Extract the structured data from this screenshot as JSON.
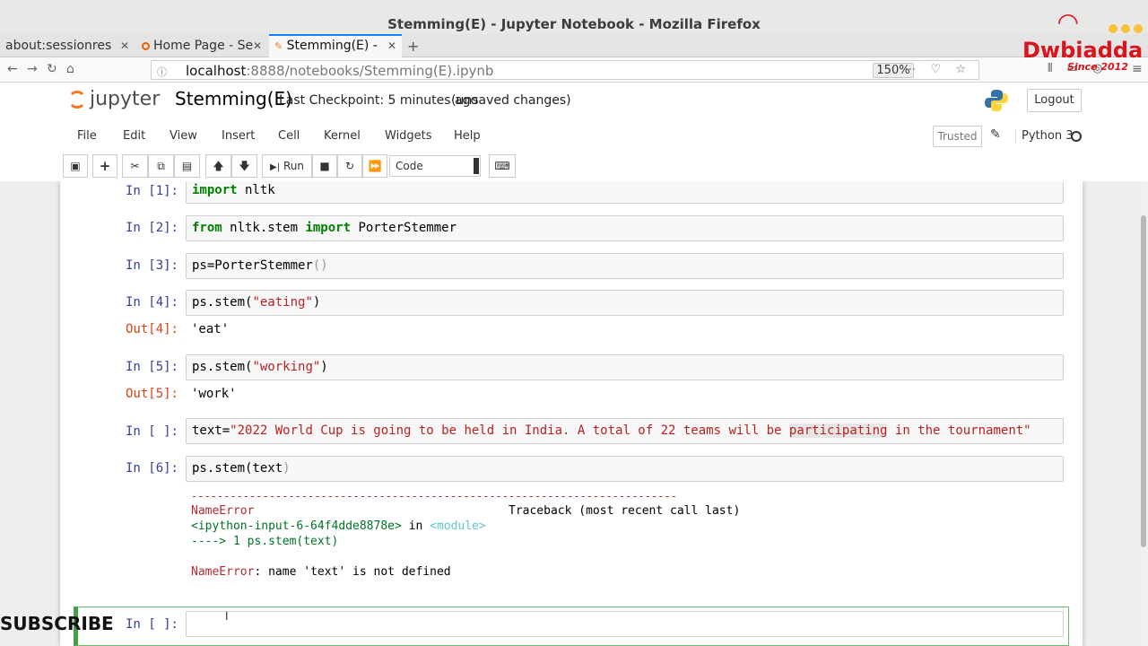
{
  "window": {
    "title": "Stemming(E) - Jupyter Notebook - Mozilla Firefox"
  },
  "tabs": [
    {
      "label": "about:sessionres"
    },
    {
      "label": "Home Page - Se"
    },
    {
      "label": "Stemming(E) -"
    }
  ],
  "address": {
    "host": "localhost",
    "path": ":8888/notebooks/Stemming(E).ipynb",
    "zoom": "150%"
  },
  "brand": {
    "name": "Dwbiadda",
    "since": "Since 2012"
  },
  "jupyter": {
    "logo_text": "jupyter",
    "notebook_name": "Stemming(E)",
    "checkpoint": "Last Checkpoint: 5 minutes ago",
    "status": "(unsaved changes)",
    "logout_label": "Logout"
  },
  "menu": {
    "items": [
      "File",
      "Edit",
      "View",
      "Insert",
      "Cell",
      "Kernel",
      "Widgets",
      "Help"
    ],
    "trusted_label": "Trusted",
    "kernel_name": "Python 3"
  },
  "toolbar": {
    "run_label": "Run",
    "cell_type": "Code"
  },
  "cells": [
    {
      "prompt": "In [1]:",
      "code": "import nltk"
    },
    {
      "prompt": "In [2]:",
      "code": "from nltk.stem import PorterStemmer"
    },
    {
      "prompt": "In [3]:",
      "code": "ps=PorterStemmer()"
    },
    {
      "prompt": "In [4]:",
      "code": "ps.stem(\"eating\")",
      "out_prompt": "Out[4]:",
      "output": "'eat'"
    },
    {
      "prompt": "In [5]:",
      "code": "ps.stem(\"working\")",
      "out_prompt": "Out[5]:",
      "output": "'work'"
    },
    {
      "prompt": "In [ ]:",
      "code": "text=\"2022 World Cup is going to be held in India. A total of 22 teams will be participating in the tournament\""
    },
    {
      "prompt": "In [6]:",
      "code": "ps.stem(text)"
    },
    {
      "prompt": "In [ ]:",
      "code": ""
    }
  ],
  "traceback": {
    "dashes": "---------------------------------------------------------------------------",
    "error_name": "NameError",
    "header_right": "Traceback (most recent call last)",
    "input_ref": "<ipython-input-6-64f4dde8878e>",
    "in_word": "in",
    "module": "<module>",
    "arrow_line": "----> 1 ps.stem(text)",
    "error_name2": "NameError",
    "message": ": name 'text' is not defined"
  },
  "overlay": {
    "subscribe": "SUBSCRIBE"
  },
  "colors": {
    "prompt_in": "#303f9f",
    "prompt_out": "#d84315",
    "keyword": "#008000",
    "string": "#ba2121",
    "error": "#b22b31",
    "selected_cell": "#42a047",
    "brand": "#d8141c",
    "tab_active": "#0a84ff"
  }
}
